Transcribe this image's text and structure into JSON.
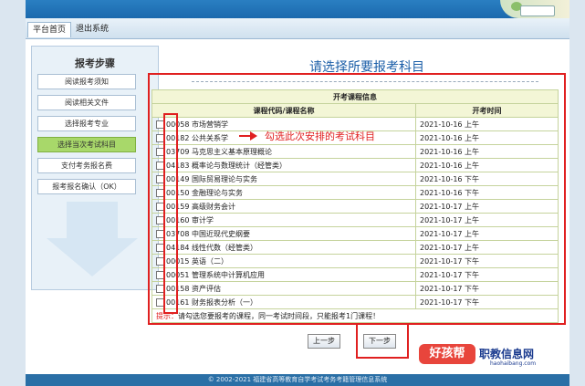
{
  "nav": {
    "tabs": [
      "平台首页",
      "退出系统"
    ]
  },
  "sidebar": {
    "title": "报考步骤",
    "items": [
      "阅读报考须知",
      "阅读相关文件",
      "选择报考专业",
      "选择当次考试科目",
      "支付考务报名费",
      "报考报名确认（OK）"
    ]
  },
  "main": {
    "title": "请选择所要报考科目",
    "table": {
      "caption": "开考课程信息",
      "col_course": "课程代码/课程名称",
      "col_time": "开考时间",
      "rows": [
        {
          "name": "00058 市场营销学",
          "time": "2021-10-16 上午"
        },
        {
          "name": "00182 公共关系学",
          "time": "2021-10-16 上午"
        },
        {
          "name": "03709 马克思主义基本原理概论",
          "time": "2021-10-16 上午"
        },
        {
          "name": "04183 概率论与数理统计（经管类）",
          "time": "2021-10-16 上午"
        },
        {
          "name": "00149 国际贸易理论与实务",
          "time": "2021-10-16 下午"
        },
        {
          "name": "00150 金融理论与实务",
          "time": "2021-10-16 下午"
        },
        {
          "name": "00159 高级财务会计",
          "time": "2021-10-17 上午"
        },
        {
          "name": "00160 审计学",
          "time": "2021-10-17 上午"
        },
        {
          "name": "03708 中国近现代史纲要",
          "time": "2021-10-17 上午"
        },
        {
          "name": "04184 线性代数（经管类）",
          "time": "2021-10-17 上午"
        },
        {
          "name": "00015 英语（二）",
          "time": "2021-10-17 下午"
        },
        {
          "name": "00051 管理系统中计算机应用",
          "time": "2021-10-17 下午"
        },
        {
          "name": "00158 资产评估",
          "time": "2021-10-17 下午"
        },
        {
          "name": "00161 财务报表分析（一）",
          "time": "2021-10-17 下午"
        }
      ],
      "tip_label": "提示：",
      "tip_text": "请勾选您要报考的课程，同一考试时间段，只能报考1门课程！"
    },
    "annotation": "勾选此次安排的考试科目",
    "prev_label": "上一步",
    "next_label": "下一步"
  },
  "watermark": {
    "badge": "好孩帮",
    "name": "职教信息网",
    "url": "haohaibang.com"
  },
  "footer": "© 2002-2021 福建省高等教育自学考试考务考籍管理信息系统"
}
